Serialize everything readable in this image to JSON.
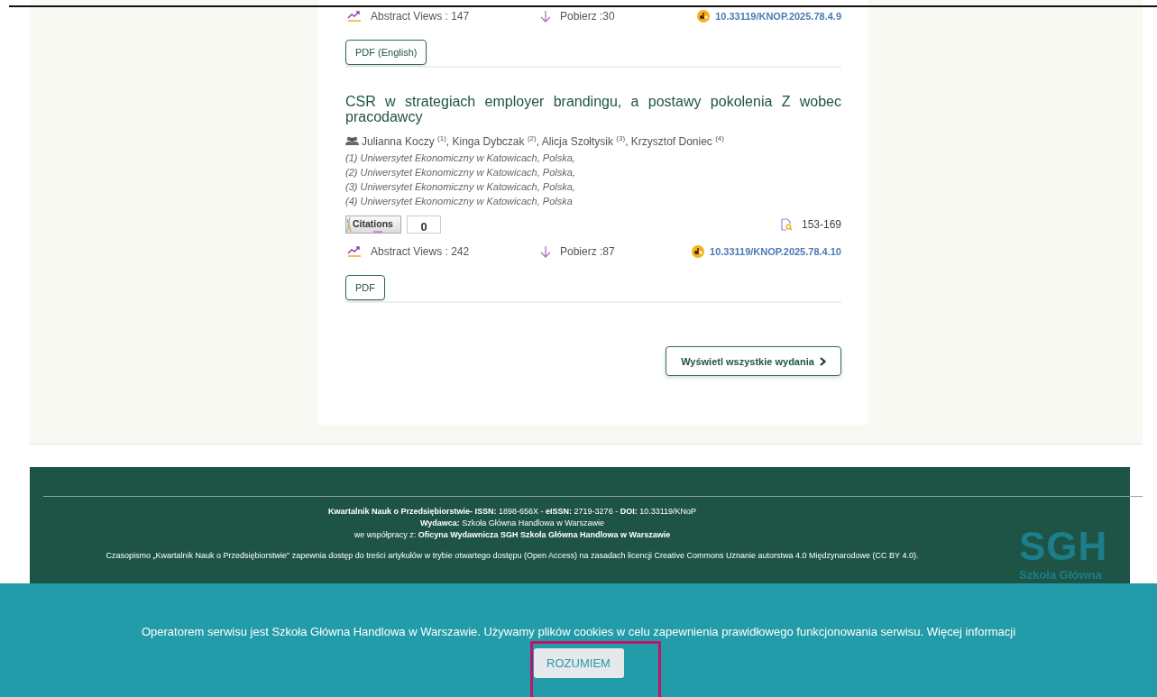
{
  "articles": [
    {
      "abstract_views": "Abstract Views : 147",
      "downloads": "Pobierz :30",
      "doi": "10.33119/KNOP.2025.78.4.9",
      "pdf_button": "PDF (English)"
    },
    {
      "title": "CSR w strategiach employer brandingu, a postawy pokolenia Z wobec pracodawcy",
      "authors": "Julianna Koczy $^{(1)}$, Kinga Dybczak $^{(2)}$, Alicja Szołtysik $^{(3)}$, Krzysztof Doniec $^{(4)}$",
      "affiliations": [
        "(1) Uniwersytet Ekonomiczny w Katowicach, Polska,",
        "(2) Uniwersytet Ekonomiczny w Katowicach, Polska,",
        "(3) Uniwersytet Ekonomiczny w Katowicach, Polska,",
        "(4) Uniwersytet Ekonomiczny w Katowicach, Polska"
      ],
      "citations": {
        "label": "Citations",
        "count": "0"
      },
      "pages": "153-169",
      "abstract_views": "Abstract Views : 242",
      "downloads": "Pobierz :87",
      "doi": "10.33119/KNOP.2025.78.4.10",
      "pdf_button": "PDF"
    }
  ],
  "all_issues_button": "Wyświetl wszystkie wydania",
  "footer": {
    "lines": [
      "**Kwartalnik Nauk o Przedsiębiorstwie- ISSN:** 1898-656X - **eISSN:** 2719-3276 - **DOI:** 10.33119/KNoP",
      "**Wydawca:** Szkoła Główna Handlowa w Warszawie",
      "we współpracy z: **Oficyna Wydawnicza SGH   Szkoła Główna Handlowa w Warszawie**"
    ],
    "license": "Czasopismo „Kwartalnik Nauk o Przedsiębiorstwie\" zapewnia dostęp do treści artykułów w trybie otwartego dostępu (Open Access) na zasadach licencji Creative Commons Uznanie autorstwa 4.0 Międzynarodowe (CC BY 4.0).",
    "logo": "SGH",
    "logo_subtitle": "Szkoła Główna"
  },
  "cookie_banner": {
    "message": "Operatorem serwisu jest Szkoła Główna Handlowa w Warszawie. Używamy plików cookies w celu zapewnienia prawidłowego funkcjonowania serwisu. Więcej informacji",
    "button": "ROZUMIEM",
    "highlighted": true
  }
}
